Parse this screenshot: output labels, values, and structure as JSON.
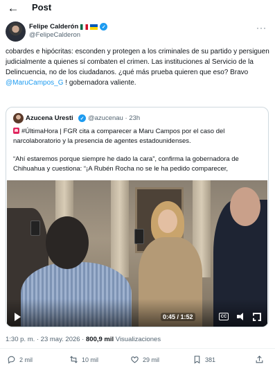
{
  "header": {
    "title": "Post"
  },
  "author": {
    "name": "Felipe Calderón",
    "handle": "@FelipeCalderon"
  },
  "tweet": {
    "text_part1": "cobardes e hipócritas: esconden y protegen a los criminales de su partido y persiguen judicialmente a quienes sí combaten el crimen. Las instituciones al Servicio de la Delincuencia, no de los ciudadanos. ¿qué más prueba quieren que eso? Bravo ",
    "mention": "@MaruCampos_G",
    "text_part2": " ! gobernadora valiente."
  },
  "quote": {
    "name": "Azucena Uresti",
    "handle": "@azucenau · 23h",
    "paragraph1": "#ÚltimaHora | FGR cita a comparecer a Maru Campos por el caso del narcolaboratorio y la presencia de agentes estadounidenses.",
    "paragraph2": "“Ahí estaremos porque siempre he dado la cara”, confirma la gobernadora de Chihuahua y cuestiona: “¡A Rubén Rocha no se le ha pedido comparecer,",
    "video_time": "0:45 / 1:52",
    "cc_label": "CC"
  },
  "meta": {
    "time": "1:30 p. m. · 23 may. 2026 · ",
    "views_count": "800,9 mil",
    "views_label": " Visualizaciones"
  },
  "actions": {
    "replies": "2 mil",
    "reposts": "10 mil",
    "likes": "29 mil",
    "bookmarks": "381"
  }
}
